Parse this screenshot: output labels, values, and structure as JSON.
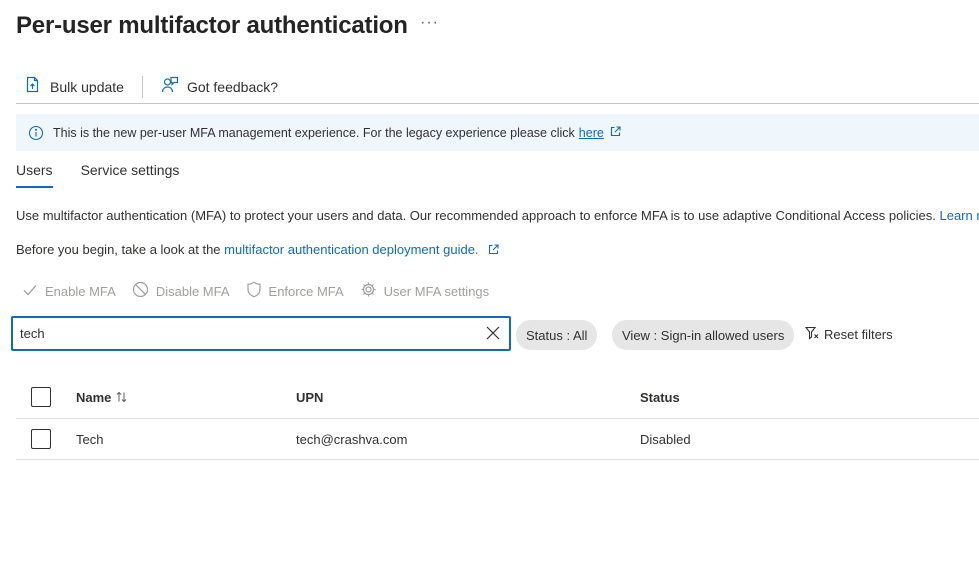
{
  "page": {
    "title": "Per-user multifactor authentication",
    "more_label": "···"
  },
  "toolbar": {
    "bulk_update": "Bulk update",
    "feedback": "Got feedback?"
  },
  "banner": {
    "text": "This is the new per-user MFA management experience. For the legacy experience please click",
    "link": "here"
  },
  "tabs": [
    {
      "label": "Users",
      "active": true
    },
    {
      "label": "Service settings",
      "active": false
    }
  ],
  "description": {
    "text": "Use multifactor authentication (MFA) to protect your users and data. Our recommended approach to enforce MFA is to use adaptive Conditional Access policies.",
    "link": "Learn m",
    "guide_prefix": "Before you begin, take a look at the",
    "guide_link": "multifactor authentication deployment guide."
  },
  "actions": {
    "enable": "Enable MFA",
    "disable": "Disable MFA",
    "enforce": "Enforce MFA",
    "settings": "User MFA settings"
  },
  "search": {
    "value": "tech"
  },
  "filters": {
    "status": "Status : All",
    "view": "View : Sign-in allowed users",
    "reset": "Reset filters"
  },
  "table": {
    "headers": {
      "name": "Name",
      "upn": "UPN",
      "status": "Status"
    },
    "rows": [
      {
        "name": "Tech",
        "upn": "tech@crashva.com",
        "status": "Disabled"
      }
    ]
  },
  "colors": {
    "accent": "#0f6cbd",
    "banner_bg": "#eff6fc",
    "disabled_text": "#a19f9d"
  }
}
